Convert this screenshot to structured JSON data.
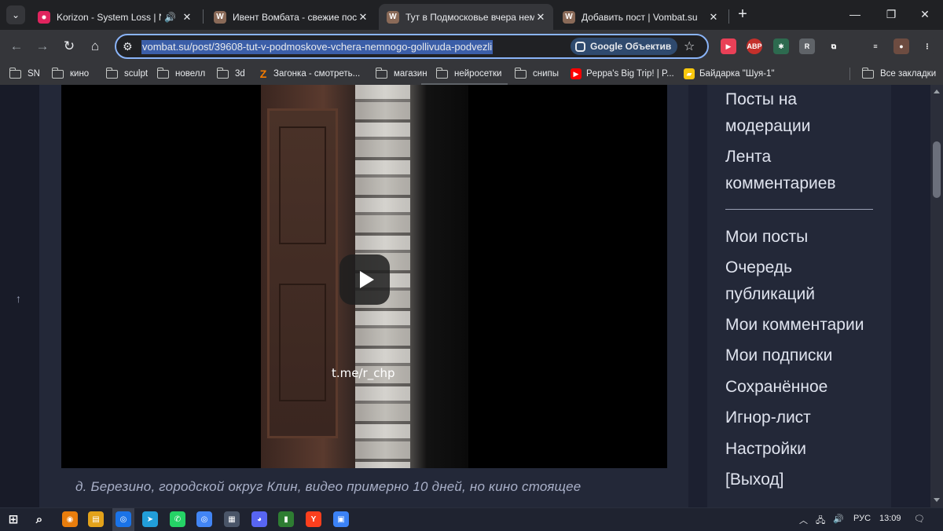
{
  "tabs": [
    {
      "title": "Korizon - System Loss | Night",
      "audio": "🔊",
      "close": "✕"
    },
    {
      "title": "Ивент Вомбата - свежие посты",
      "close": "✕"
    },
    {
      "title": "Тут в Подмосковье вчера немн",
      "close": "✕"
    },
    {
      "title": "Добавить пост | Vombat.su",
      "close": "✕"
    }
  ],
  "tab_menu": "⌄",
  "new_tab": "+",
  "window_controls": {
    "minimize": "—",
    "restore": "❐",
    "close": "✕"
  },
  "nav": {
    "back": "←",
    "forward": "→",
    "reload": "↻",
    "home": "⌂"
  },
  "address": {
    "url": "vombat.su/post/39608-tut-v-podmoskove-vchera-nemnogo-gollivuda-podvezli",
    "lens_label": "Google Объектив",
    "site_info_icon": "⚙",
    "star": "☆"
  },
  "extensions": [
    {
      "name": "media-icon",
      "glyph": "▶",
      "color": "#e94057"
    },
    {
      "name": "adblock-icon",
      "glyph": "ABP",
      "color": "#c4302b"
    },
    {
      "name": "puzzle-color-icon",
      "glyph": "✱",
      "color": "#2d6a4f"
    },
    {
      "name": "r-extension-icon",
      "glyph": "R",
      "color": "#5f6368"
    },
    {
      "name": "extensions-icon",
      "glyph": "⧉",
      "color": "#35363a"
    },
    {
      "name": "media-control-icon",
      "glyph": "≡",
      "color": "#35363a"
    },
    {
      "name": "profile-avatar-icon",
      "glyph": "●",
      "color": "#6d4c41"
    },
    {
      "name": "menu-icon",
      "glyph": "⋮",
      "color": "#35363a"
    }
  ],
  "bookmarks": [
    {
      "label": "SN",
      "type": "folder"
    },
    {
      "label": "кино",
      "type": "folder"
    },
    {
      "label": "sculpt",
      "type": "folder"
    },
    {
      "label": "новелл",
      "type": "folder"
    },
    {
      "label": "3d",
      "type": "folder"
    },
    {
      "label": "Загонка - смотреть...",
      "type": "site",
      "glyph": "Z",
      "color": "#f57c00"
    },
    {
      "label": "магазин",
      "type": "folder"
    },
    {
      "label": "нейросетки",
      "type": "folder"
    },
    {
      "label": "снипы",
      "type": "folder"
    },
    {
      "label": "Peppa's Big Trip! | P...",
      "type": "site",
      "glyph": "▶",
      "color": "#ff0000"
    },
    {
      "label": "Байдарка \"Шуя-1\"",
      "type": "site",
      "glyph": "▰",
      "color": "#f9c80e"
    }
  ],
  "all_bookmarks": "Все закладки",
  "video": {
    "watermark": "t.me/r_chp"
  },
  "caption": "д. Березино, городской округ Клин, видео примерно 10 дней, но кино стоящее",
  "scroll_up": "↑",
  "sidebar": {
    "items_top": [
      "Посты на модерации",
      "Лента комментариев"
    ],
    "items": [
      "Мои посты",
      "Очередь публикаций",
      "Мои комментарии",
      "Мои подписки",
      "Сохранённое",
      "Игнор-лист",
      "Настройки",
      "[Выход]"
    ]
  },
  "taskbar": {
    "apps": [
      {
        "name": "start-icon",
        "glyph": "⊞",
        "color": "#1f2330"
      },
      {
        "name": "search-icon",
        "glyph": "⌕",
        "color": "#1f2330"
      },
      {
        "name": "blender-icon",
        "glyph": "◉",
        "color": "#e87d0d"
      },
      {
        "name": "file-explorer-icon",
        "glyph": "▤",
        "color": "#e3a21a"
      },
      {
        "name": "chrome-icon",
        "glyph": "◎",
        "color": "#1a73e8"
      },
      {
        "name": "telegram-icon",
        "glyph": "➤",
        "color": "#229ed9"
      },
      {
        "name": "whatsapp-icon",
        "glyph": "✆",
        "color": "#25d366"
      },
      {
        "name": "chrome-alt-icon",
        "glyph": "◎",
        "color": "#4285f4"
      },
      {
        "name": "calculator-icon",
        "glyph": "▦",
        "color": "#4a5568"
      },
      {
        "name": "discord-icon",
        "glyph": "◕",
        "color": "#5865f2"
      },
      {
        "name": "green-app-icon",
        "glyph": "▮",
        "color": "#2e7d32"
      },
      {
        "name": "yandex-icon",
        "glyph": "Y",
        "color": "#fc3f1d"
      },
      {
        "name": "photos-icon",
        "glyph": "▣",
        "color": "#3b82f6"
      }
    ],
    "tray": {
      "chevron": "︿",
      "network": "🖧",
      "volume": "🔊",
      "language": "РУС",
      "time": "13:09",
      "notifications": "🗨"
    }
  }
}
